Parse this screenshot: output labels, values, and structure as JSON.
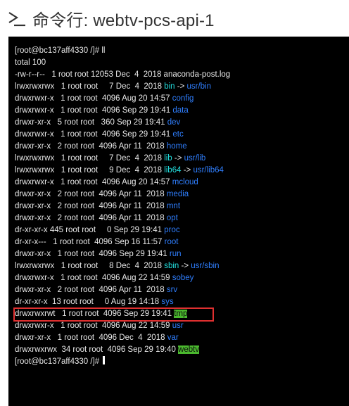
{
  "header": {
    "icon": "terminal-prompt-icon",
    "title": "命令行: webtv-pcs-api-1"
  },
  "colors": {
    "link": "#2f7fff",
    "executable_dir": "#22e0e0",
    "sticky_dir_bg": "#4ab82e",
    "highlight_border": "#e03030"
  },
  "terminal": {
    "lines": [
      {
        "prefix": "[root@bc137aff4330 /]# ll",
        "name": "",
        "arrow": "",
        "target": ""
      },
      {
        "prefix": "total 100",
        "name": "",
        "arrow": "",
        "target": ""
      },
      {
        "prefix": "-rw-r--r--   1 root root 12053 Dec  4  2018 anaconda-post.log",
        "name": "",
        "arrow": "",
        "target": ""
      },
      {
        "prefix": "lrwxrwxrwx   1 root root     7 Dec  4  2018 ",
        "name": "bin",
        "arrow": " -> ",
        "target": "usr/bin"
      },
      {
        "prefix": "drwxrwxr-x   1 root root  4096 Aug 20 14:57 ",
        "name": "config",
        "arrow": "",
        "target": ""
      },
      {
        "prefix": "drwxrwxr-x   1 root root  4096 Sep 29 19:41 ",
        "name": "data",
        "arrow": "",
        "target": ""
      },
      {
        "prefix": "drwxr-xr-x   5 root root   360 Sep 29 19:41 ",
        "name": "dev",
        "arrow": "",
        "target": ""
      },
      {
        "prefix": "drwxrwxr-x   1 root root  4096 Sep 29 19:41 ",
        "name": "etc",
        "arrow": "",
        "target": ""
      },
      {
        "prefix": "drwxr-xr-x   2 root root  4096 Apr 11  2018 ",
        "name": "home",
        "arrow": "",
        "target": ""
      },
      {
        "prefix": "lrwxrwxrwx   1 root root     7 Dec  4  2018 ",
        "name": "lib",
        "arrow": " -> ",
        "target": "usr/lib"
      },
      {
        "prefix": "lrwxrwxrwx   1 root root     9 Dec  4  2018 ",
        "name": "lib64",
        "arrow": " -> ",
        "target": "usr/lib64"
      },
      {
        "prefix": "drwxrwxr-x   1 root root  4096 Aug 20 14:57 ",
        "name": "mcloud",
        "arrow": "",
        "target": ""
      },
      {
        "prefix": "drwxr-xr-x   2 root root  4096 Apr 11  2018 ",
        "name": "media",
        "arrow": "",
        "target": ""
      },
      {
        "prefix": "drwxr-xr-x   2 root root  4096 Apr 11  2018 ",
        "name": "mnt",
        "arrow": "",
        "target": ""
      },
      {
        "prefix": "drwxr-xr-x   2 root root  4096 Apr 11  2018 ",
        "name": "opt",
        "arrow": "",
        "target": ""
      },
      {
        "prefix": "dr-xr-xr-x 445 root root     0 Sep 29 19:41 ",
        "name": "proc",
        "arrow": "",
        "target": ""
      },
      {
        "prefix": "dr-xr-x---   1 root root  4096 Sep 16 11:57 ",
        "name": "root",
        "arrow": "",
        "target": ""
      },
      {
        "prefix": "drwxr-xr-x   1 root root  4096 Sep 29 19:41 ",
        "name": "run",
        "arrow": "",
        "target": ""
      },
      {
        "prefix": "lrwxrwxrwx   1 root root     8 Dec  4  2018 ",
        "name": "sbin",
        "arrow": " -> ",
        "target": "usr/sbin"
      },
      {
        "prefix": "drwxrwxr-x   1 root root  4096 Aug 22 14:59 ",
        "name": "sobey",
        "arrow": "",
        "target": ""
      },
      {
        "prefix": "drwxr-xr-x   2 root root  4096 Apr 11  2018 ",
        "name": "srv",
        "arrow": "",
        "target": ""
      },
      {
        "prefix": "dr-xr-xr-x  13 root root     0 Aug 19 14:18 ",
        "name": "sys",
        "arrow": "",
        "target": ""
      },
      {
        "prefix": "drwxrwxrwt   1 root root  4096 Sep 29 19:41 ",
        "name": "tmp",
        "arrow": "",
        "target": ""
      },
      {
        "prefix": "drwxrwxr-x   1 root root  4096 Aug 22 14:59 ",
        "name": "usr",
        "arrow": "",
        "target": ""
      },
      {
        "prefix": "drwxr-xr-x   1 root root  4096 Dec  4  2018 ",
        "name": "var",
        "arrow": "",
        "target": ""
      },
      {
        "prefix": "drwxrwxrwx  34 root root  4096 Sep 29 19:40 ",
        "name": "webtv",
        "arrow": "",
        "target": ""
      },
      {
        "prefix": "[root@bc137aff4330 /]# ",
        "name": "",
        "arrow": "",
        "target": ""
      }
    ]
  }
}
